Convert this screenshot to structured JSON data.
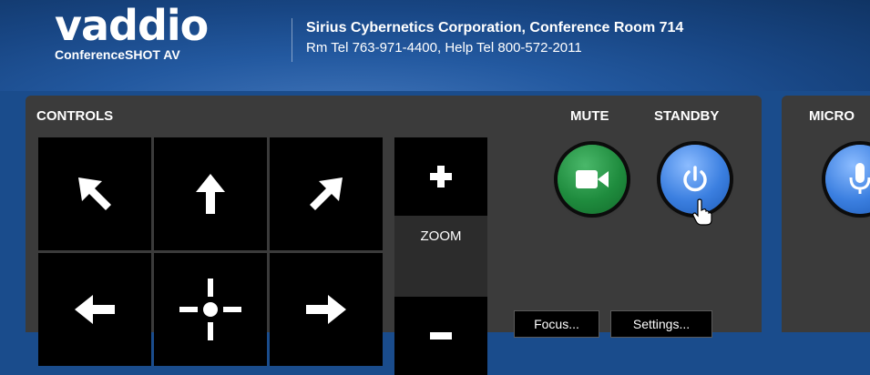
{
  "header": {
    "logo_text": "vaddio",
    "product_name": "ConferenceSHOT AV",
    "room_title": "Sirius Cybernetics Corporation, Conference Room 714",
    "room_contact": "Rm Tel 763-971-4400, Help Tel 800-572-2011"
  },
  "controls": {
    "title": "CONTROLS",
    "zoom_label": "ZOOM",
    "mute_label": "MUTE",
    "standby_label": "STANDBY",
    "focus_button": "Focus...",
    "settings_button": "Settings..."
  },
  "mic_panel": {
    "title": "MICRO"
  },
  "colors": {
    "header_bg": "#184684",
    "panel_bg": "#3b3b3b",
    "mute_green": "#1f8c3e",
    "standby_blue": "#3b7fe0"
  },
  "icons": {
    "ptz": [
      "arrow-up-left-icon",
      "arrow-up-icon",
      "arrow-up-right-icon",
      "arrow-left-icon",
      "home-crosshair-icon",
      "arrow-right-icon"
    ],
    "zoom": [
      "plus-icon",
      "minus-icon"
    ],
    "mute": "video-camera-icon",
    "standby": "power-icon",
    "mic": "microphone-icon",
    "cursor": "hand-pointer-icon"
  }
}
